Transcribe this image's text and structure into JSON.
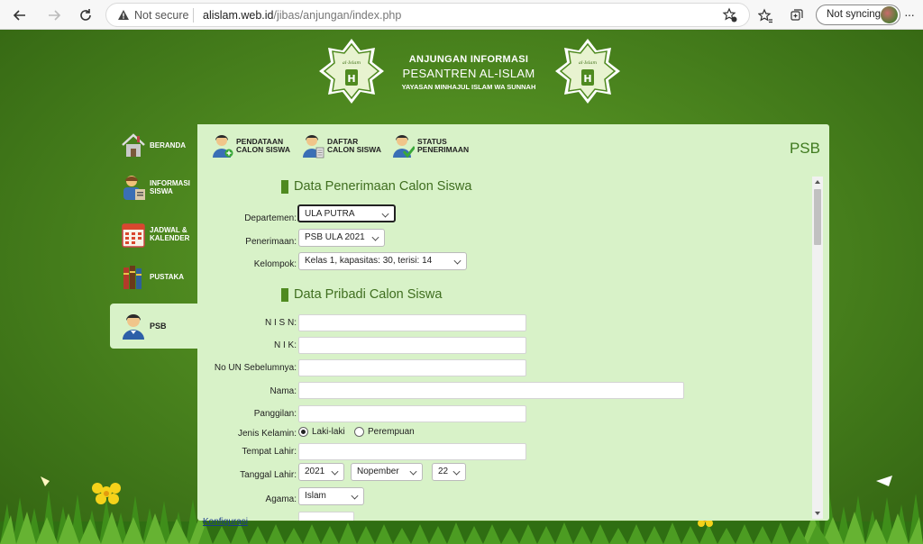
{
  "browser": {
    "not_secure": "Not secure",
    "url_host": "alislam.web.id",
    "url_path": "/jibas/anjungan/index.php",
    "sync_label": "Not syncing"
  },
  "header": {
    "line1": "ANJUNGAN INFORMASI",
    "line2": "PESANTREN AL-ISLAM",
    "line3": "YAYASAN MINHAJUL ISLAM WA SUNNAH"
  },
  "side_menu": [
    {
      "label1": "BERANDA",
      "label2": "",
      "icon": "home-icon"
    },
    {
      "label1": "INFORMASI",
      "label2": "SISWA",
      "icon": "student-info-icon"
    },
    {
      "label1": "JADWAL &",
      "label2": "KALENDER",
      "icon": "calendar-icon"
    },
    {
      "label1": "PUSTAKA",
      "label2": "",
      "icon": "books-icon"
    },
    {
      "label1": "PSB",
      "label2": "",
      "icon": "user-icon"
    }
  ],
  "tabs": [
    {
      "label1": "PENDATAAN",
      "label2": "CALON SISWA"
    },
    {
      "label1": "DAFTAR",
      "label2": "CALON SISWA"
    },
    {
      "label1": "STATUS",
      "label2": "PENERIMAAN"
    }
  ],
  "panel_title": "PSB",
  "section1_title": "Data Penerimaan Calon Siswa",
  "section2_title": "Data Pribadi Calon Siswa",
  "fields": {
    "departemen_label": "Departemen:",
    "departemen_value": "ULA PUTRA",
    "penerimaan_label": "Penerimaan:",
    "penerimaan_value": "PSB ULA 2021",
    "kelompok_label": "Kelompok:",
    "kelompok_value": "Kelas 1, kapasitas: 30, terisi: 14",
    "nisn_label": "N I S N:",
    "nik_label": "N I K:",
    "noun_label": "No UN Sebelumnya:",
    "nama_label": "Nama:",
    "panggilan_label": "Panggilan:",
    "jk_label": "Jenis Kelamin:",
    "jk_male": "Laki-laki",
    "jk_female": "Perempuan",
    "tempat_label": "Tempat Lahir:",
    "tanggal_label": "Tanggal Lahir:",
    "tahun_value": "2021",
    "bulan_value": "Nopember",
    "hari_value": "22",
    "agama_label": "Agama:",
    "agama_value": "Islam"
  },
  "footer_link": "Konfigurasi"
}
